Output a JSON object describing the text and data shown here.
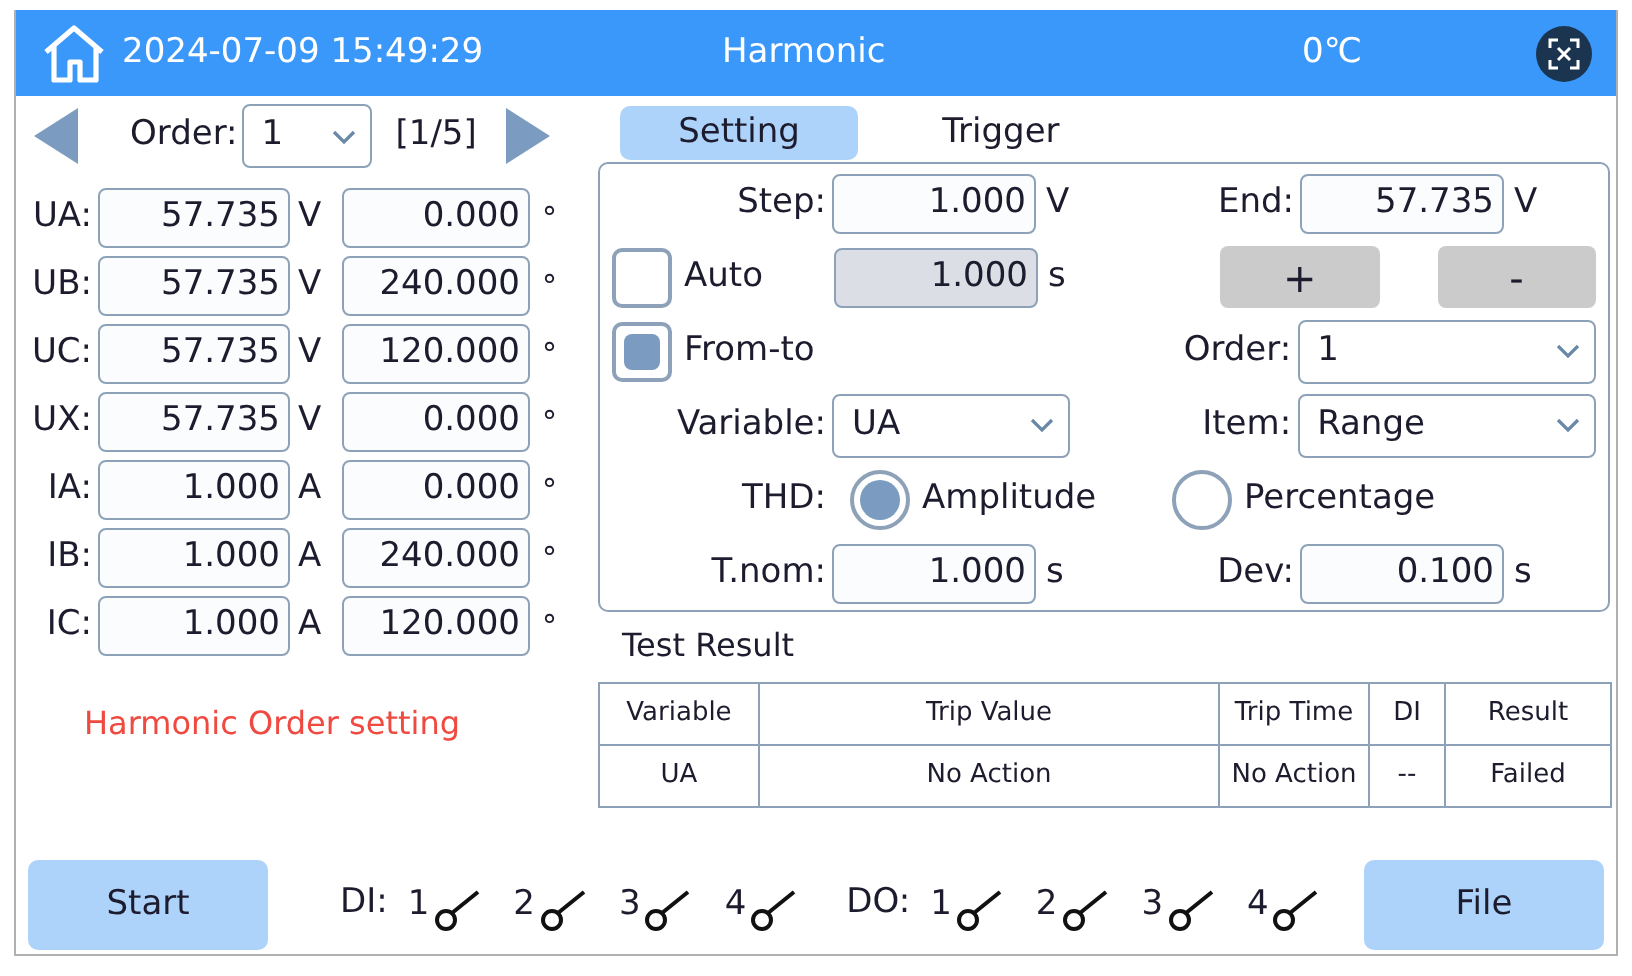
{
  "header": {
    "datetime": "2024-07-09 15:49:29",
    "title": "Harmonic",
    "temperature": "0℃"
  },
  "order_nav": {
    "label": "Order:",
    "value": "1",
    "page": "[1/5]"
  },
  "channels": [
    {
      "name": "UA:",
      "amplitude": "57.735",
      "unit": "V",
      "angle": "0.000",
      "angle_unit": "°"
    },
    {
      "name": "UB:",
      "amplitude": "57.735",
      "unit": "V",
      "angle": "240.000",
      "angle_unit": "°"
    },
    {
      "name": "UC:",
      "amplitude": "57.735",
      "unit": "V",
      "angle": "120.000",
      "angle_unit": "°"
    },
    {
      "name": "UX:",
      "amplitude": "57.735",
      "unit": "V",
      "angle": "0.000",
      "angle_unit": "°"
    },
    {
      "name": "IA:",
      "amplitude": "1.000",
      "unit": "A",
      "angle": "0.000",
      "angle_unit": "°"
    },
    {
      "name": "IB:",
      "amplitude": "1.000",
      "unit": "A",
      "angle": "240.000",
      "angle_unit": "°"
    },
    {
      "name": "IC:",
      "amplitude": "1.000",
      "unit": "A",
      "angle": "120.000",
      "angle_unit": "°"
    }
  ],
  "message": "Harmonic Order setting",
  "tabs": [
    {
      "label": "Setting",
      "selected": true
    },
    {
      "label": "Trigger",
      "selected": false
    }
  ],
  "setting": {
    "step": {
      "label": "Step:",
      "value": "1.000",
      "unit": "V"
    },
    "end": {
      "label": "End:",
      "value": "57.735",
      "unit": "V"
    },
    "auto": {
      "label": "Auto",
      "checked": false,
      "value": "1.000",
      "unit": "s",
      "disabled": true
    },
    "buttons": [
      "+",
      "-"
    ],
    "from_to": {
      "label": "From-to",
      "checked": true
    },
    "order": {
      "label": "Order:",
      "value": "1"
    },
    "variable": {
      "label": "Variable:",
      "value": "UA"
    },
    "item": {
      "label": "Item:",
      "value": "Range"
    },
    "thd": {
      "label": "THD:",
      "options": [
        {
          "label": "Amplitude",
          "selected": true
        },
        {
          "label": "Percentage",
          "selected": false
        }
      ]
    },
    "tnom": {
      "label": "T.nom:",
      "value": "1.000",
      "unit": "s"
    },
    "dev": {
      "label": "Dev:",
      "value": "0.100",
      "unit": "s"
    }
  },
  "test_result": {
    "title": "Test Result",
    "columns": [
      "Variable",
      "Trip Value",
      "Trip Time",
      "DI",
      "Result"
    ],
    "rows": [
      [
        "UA",
        "No Action",
        "No Action",
        "--",
        "Failed"
      ]
    ]
  },
  "footer": {
    "start": "Start",
    "di": {
      "label": "DI:",
      "items": [
        "1",
        "2",
        "3",
        "4"
      ]
    },
    "do": {
      "label": "DO:",
      "items": [
        "1",
        "2",
        "3",
        "4"
      ]
    },
    "file": "File"
  }
}
